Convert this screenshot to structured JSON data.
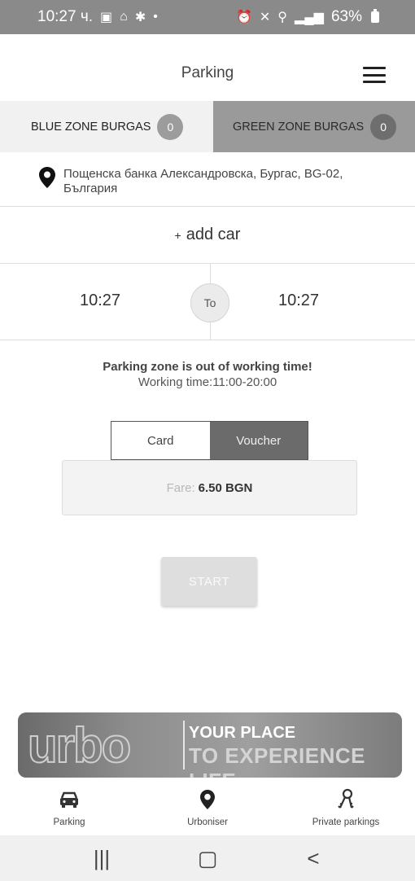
{
  "status_bar": {
    "time": "10:27 ч.",
    "left_icons": [
      "gallery-icon",
      "home-icon",
      "accessibility-icon",
      "dot-icon"
    ],
    "right_icons": [
      "alarm-icon",
      "mute-icon",
      "location-icon",
      "volte-icon",
      "signal-icon"
    ],
    "battery": "63%"
  },
  "header": {
    "title": "Parking"
  },
  "zones": [
    {
      "label": "BLUE ZONE BURGAS",
      "count": "0"
    },
    {
      "label": "GREEN ZONE BURGAS",
      "count": "0"
    }
  ],
  "address": {
    "text": "Пощенска банка Александровска, Бургас, BG-02, България"
  },
  "add_car": {
    "plus": "+",
    "label": "add car"
  },
  "time": {
    "from": "10:27",
    "to_label": "To",
    "to": "10:27"
  },
  "notice": {
    "line1": "Parking zone is out of working time!",
    "line2": "Working time:11:00-20:00"
  },
  "payment": {
    "card_label": "Card",
    "voucher_label": "Voucher"
  },
  "fare": {
    "label": "Fare:",
    "value": "6.50 BGN"
  },
  "start": {
    "label": "START"
  },
  "banner": {
    "logo": "urbo",
    "slogan_1": "YOUR PLACE",
    "slogan_2": "TO EXPERIENCE LIFE"
  },
  "bottom_nav": [
    {
      "label": "Parking",
      "icon": "car-icon"
    },
    {
      "label": "Urboniser",
      "icon": "pin-icon"
    },
    {
      "label": "Private parkings",
      "icon": "keys-icon"
    }
  ],
  "system_nav": {
    "recents": "|||",
    "home": "▢",
    "back": "<"
  },
  "colors": {
    "status_bar": "#8a8a8a",
    "green_zone_tab": "#9a9a9a",
    "voucher_active": "#6b6b6b",
    "start_disabled": "#dedede"
  }
}
